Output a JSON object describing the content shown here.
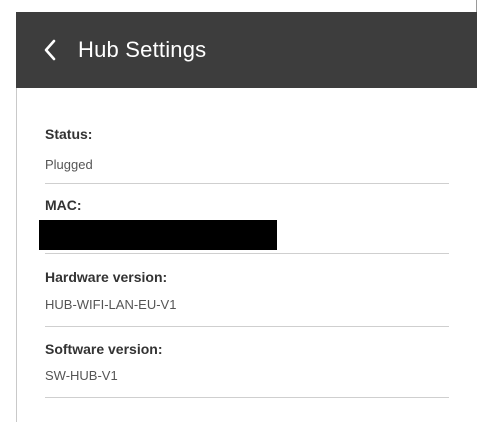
{
  "header": {
    "title": "Hub Settings",
    "back_icon": "chevron-left-icon",
    "background_color": "#3d3d3d",
    "text_color": "#ffffff"
  },
  "fields": [
    {
      "label": "Status:",
      "value": "Plugged"
    },
    {
      "label": "MAC:",
      "value": ""
    },
    {
      "label": "Hardware version:",
      "value": "HUB-WIFI-LAN-EU-V1"
    },
    {
      "label": "Software version:",
      "value": "SW-HUB-V1"
    }
  ]
}
